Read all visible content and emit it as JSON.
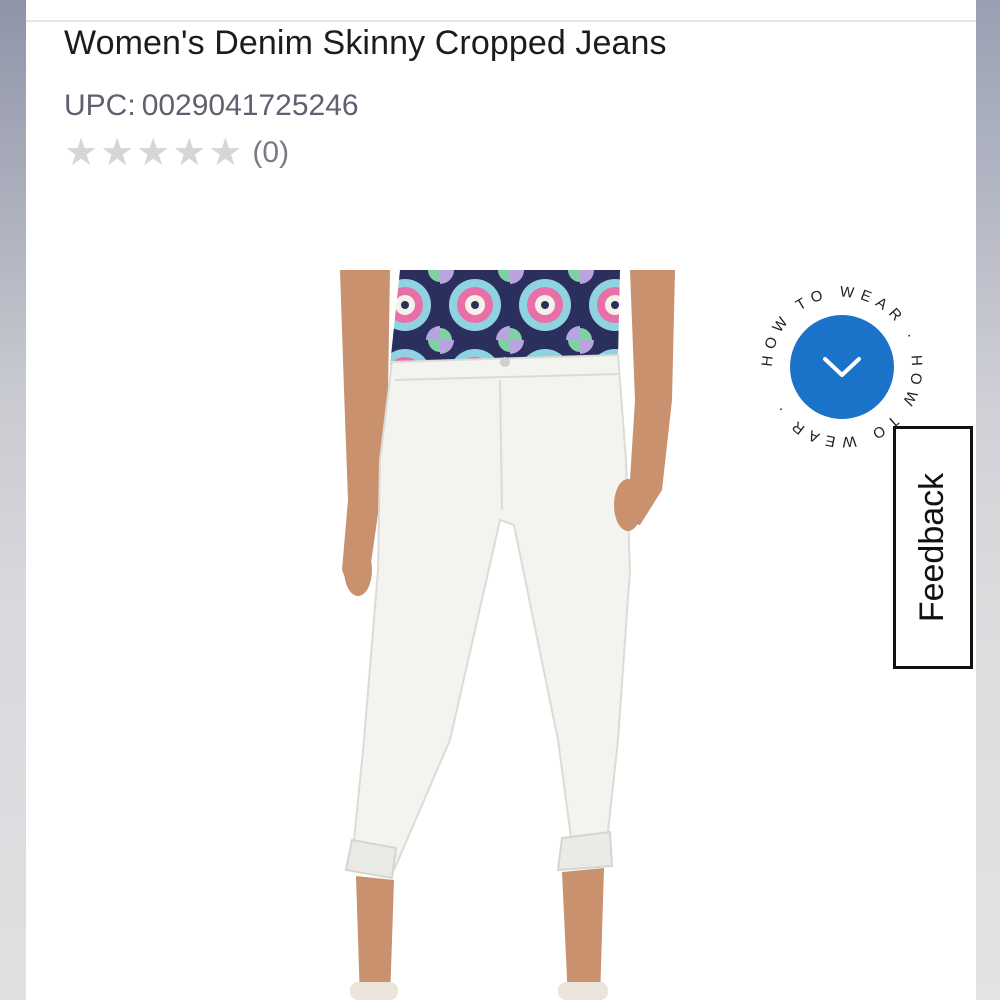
{
  "product": {
    "title": "Women's Denim Skinny Cropped Jeans",
    "upc_label": "UPC:",
    "upc_value": "0029041725246",
    "rating": {
      "stars_filled": 0,
      "stars_total": 5,
      "review_count": "(0)"
    }
  },
  "how_to_wear": {
    "ring_text": "HOW TO WEAR · HOW TO WEAR ·",
    "button_icon": "chevron-down-icon",
    "accent_color": "#1a73c9"
  },
  "feedback": {
    "label": "Feedback"
  },
  "icons": {
    "star": "★"
  }
}
